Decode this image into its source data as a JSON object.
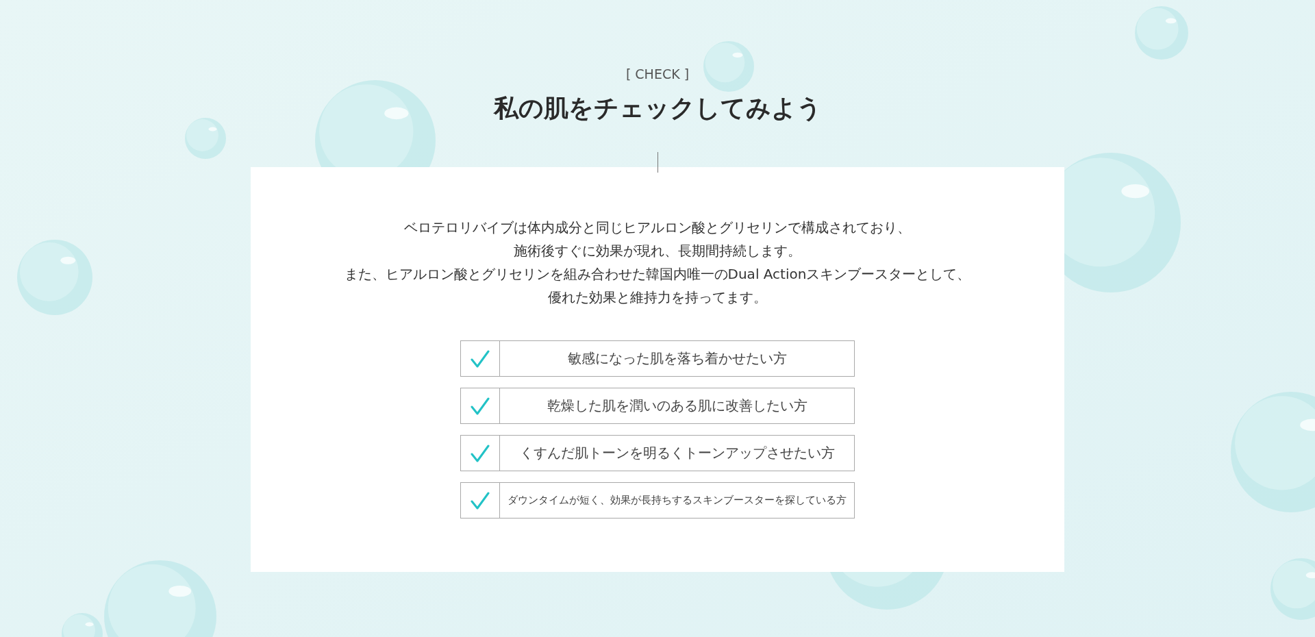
{
  "label": "[ CHECK ]",
  "title": "私の肌をチェックしてみよう",
  "description": [
    "ベロテロリバイブは体内成分と同じヒアルロン酸とグリセリンで構成されており、",
    "施術後すぐに効果が現れ、長期間持続します。",
    "また、ヒアルロン酸とグリセリンを組み合わせた韓国内唯一のDual Actionスキンブースターとして、",
    "優れた効果と維持力を持ってます。"
  ],
  "checklist": [
    {
      "text": "敏感になった肌を落ち着かせたい方",
      "checked": true,
      "compact": false
    },
    {
      "text": "乾燥した肌を潤いのある肌に改善したい方",
      "checked": true,
      "compact": false
    },
    {
      "text": "くすんだ肌トーンを明るくトーンアップさせたい方",
      "checked": true,
      "compact": false
    },
    {
      "text": "ダウンタイムが短く、効果が長持ちするスキンブースターを探している方",
      "checked": true,
      "compact": true
    }
  ]
}
